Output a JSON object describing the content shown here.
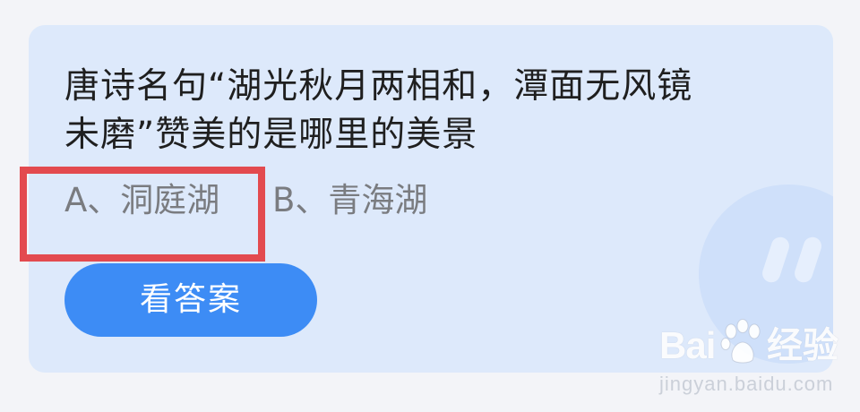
{
  "question": {
    "line1": "唐诗名句“湖光秋月两相和，潭面无风镜",
    "line2": "未磨”赞美的是哪里的美景"
  },
  "options": [
    {
      "label": "A、洞庭湖"
    },
    {
      "label": "B、青海湖"
    }
  ],
  "answer_button": {
    "label": "看答案"
  },
  "watermark": {
    "brand_prefix": "Bai",
    "brand_suffix": "经验",
    "url": "jingyan.baidu.com",
    "paw_icon": "baidu-paw-icon"
  },
  "colors": {
    "page_bg": "#f3f4f8",
    "card_bg": "#dde9fb",
    "button_bg": "#3d8cf5",
    "highlight": "#e34a4f"
  }
}
